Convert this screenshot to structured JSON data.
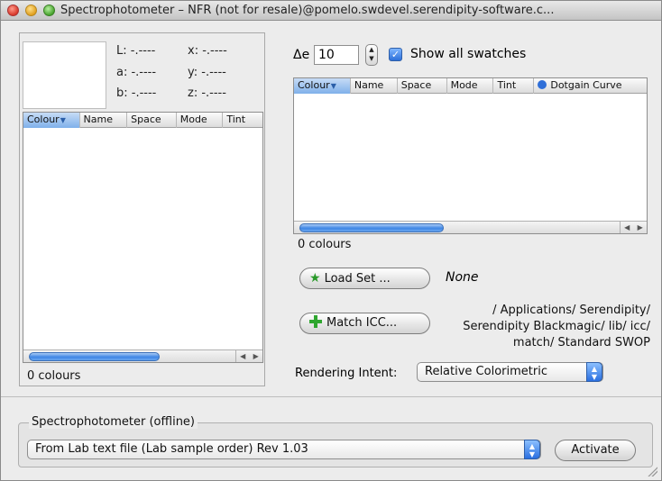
{
  "window": {
    "title": "Spectrophotometer – NFR (not for resale)@pomelo.swdevel.serendipity-software.c..."
  },
  "readout": {
    "L": "L:  -.----",
    "a": "a:  -.----",
    "b": "b:  -.----",
    "x": "x:  -.----",
    "y": "y:  -.----",
    "z": "z:  -.----"
  },
  "left_table": {
    "columns": [
      "Colour",
      "Name",
      "Space",
      "Mode",
      "Tint"
    ],
    "sorted_column": "Colour",
    "rows": [],
    "count_label": "0 colours"
  },
  "delta_e": {
    "label": "Δe",
    "value": "10"
  },
  "show_all_swatches": {
    "label": "Show all swatches",
    "checked": true
  },
  "right_table": {
    "columns": [
      "Colour",
      "Name",
      "Space",
      "Mode",
      "Tint",
      "Dotgain Curve"
    ],
    "sorted_column": "Colour",
    "rows": [],
    "count_label": "0 colours"
  },
  "load_set": {
    "button_label": "Load Set ...",
    "current_value": "None"
  },
  "match_icc": {
    "button_label": "Match ICC...",
    "path": "/ Applications/ Serendipity/ Serendipity Blackmagic/ lib/ icc/ match/ Standard SWOP"
  },
  "rendering_intent": {
    "label": "Rendering Intent:",
    "selected": "Relative Colorimetric"
  },
  "device": {
    "group_title": "Spectrophotometer (offline)",
    "selected": "From Lab text file (Lab sample order) Rev 1.03",
    "activate_label": "Activate"
  },
  "icons": {
    "load_set_icon": "star-icon",
    "match_icc_icon": "plus-icon",
    "dotgain_icon": "circle-icon",
    "accent_color": "#2f6fd8",
    "icon_green": "#2fa62f"
  }
}
